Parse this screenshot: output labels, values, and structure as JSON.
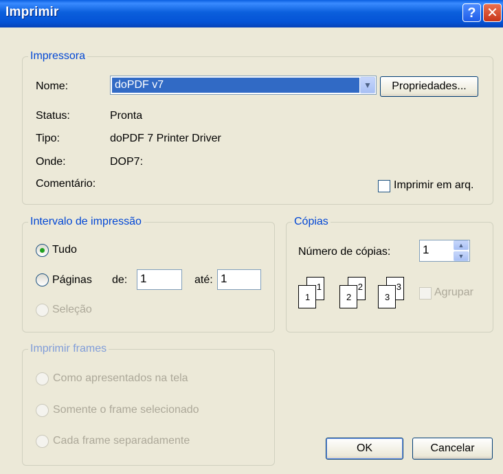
{
  "window": {
    "title": "Imprimir",
    "help_glyph": "?",
    "close_glyph": "✕"
  },
  "printer": {
    "legend": "Impressora",
    "name_label": "Nome:",
    "name_value": "doPDF v7",
    "properties_button": "Propriedades...",
    "status_label": "Status:",
    "status_value": "Pronta",
    "type_label": "Tipo:",
    "type_value": "doPDF 7 Printer Driver",
    "where_label": "Onde:",
    "where_value": "DOP7:",
    "comment_label": "Comentário:",
    "print_to_file_label": "Imprimir em arq.",
    "print_to_file_checked": false
  },
  "range": {
    "legend": "Intervalo de impressão",
    "all_label": "Tudo",
    "pages_label": "Páginas",
    "from_label": "de:",
    "from_value": "1",
    "to_label": "até:",
    "to_value": "1",
    "selection_label": "Seleção",
    "selected": "all"
  },
  "copies": {
    "legend": "Cópias",
    "count_label": "Número de cópias:",
    "count_value": "1",
    "collate_label": "Agrupar",
    "collate_checked": false,
    "collate_pages": [
      "1",
      "1",
      "2",
      "2",
      "3",
      "3"
    ]
  },
  "frames": {
    "legend": "Imprimir frames",
    "as_laid_out_label": "Como apresentados na tela",
    "selected_frame_label": "Somente o frame selecionado",
    "each_frame_label": "Cada frame separadamente"
  },
  "buttons": {
    "ok": "OK",
    "cancel": "Cancelar"
  }
}
